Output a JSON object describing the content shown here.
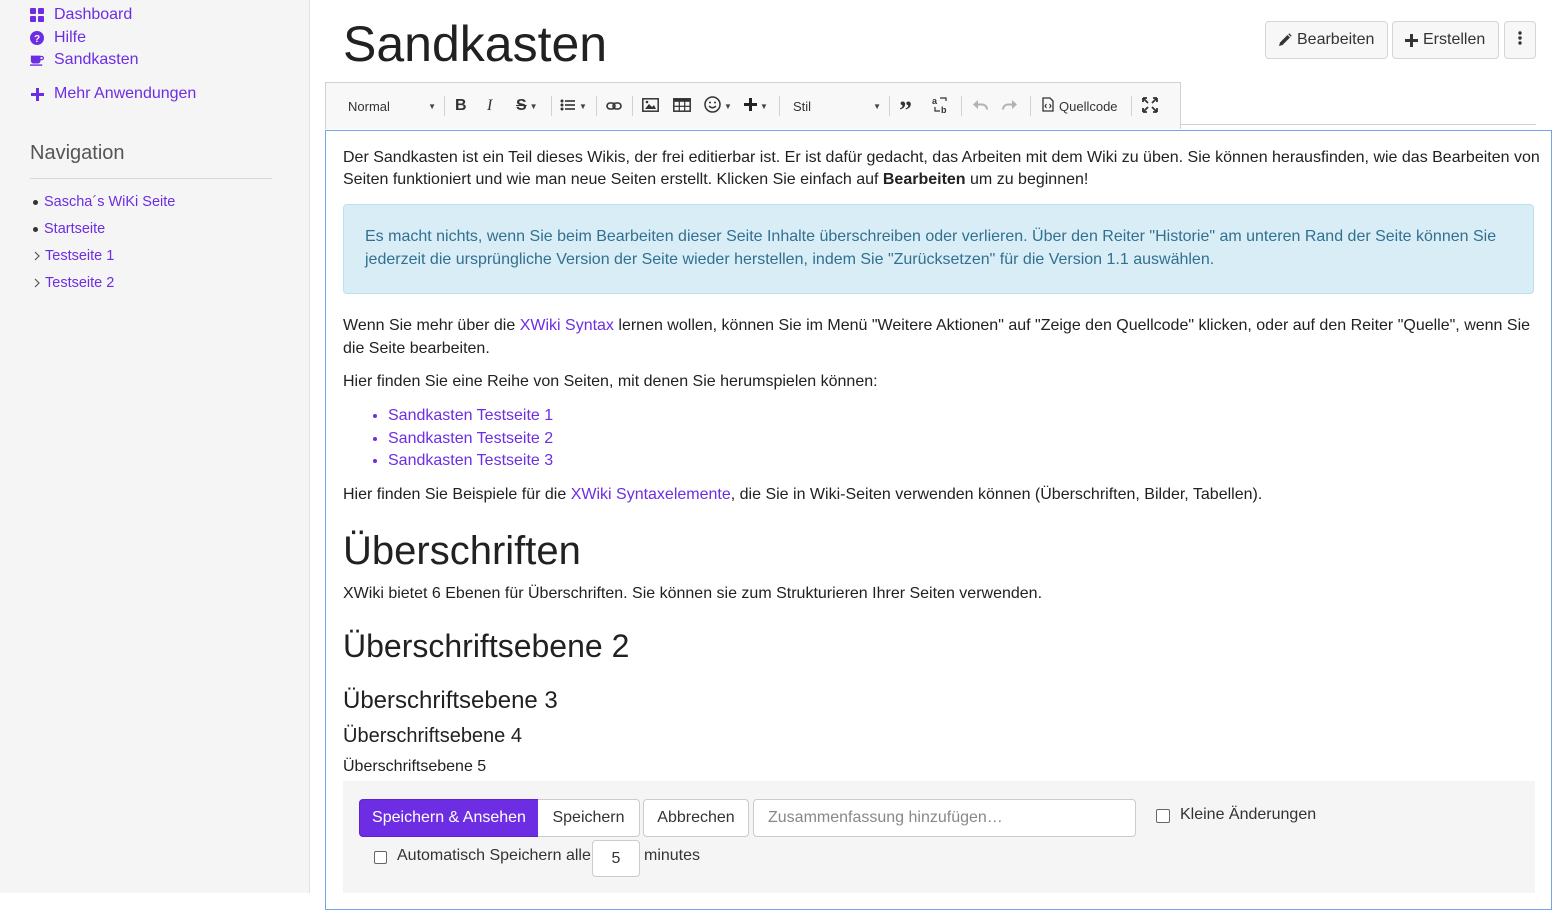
{
  "sidebar": {
    "apps": [
      {
        "label": "Dashboard",
        "icon": "dashboard-icon"
      },
      {
        "label": "Hilfe",
        "icon": "help-icon"
      },
      {
        "label": "Sandkasten",
        "icon": "coffee-icon"
      }
    ],
    "more_apps": "Mehr Anwendungen",
    "nav_title": "Navigation",
    "nav_items": [
      {
        "label": "Sascha´s WiKi Seite",
        "marker": "bullet"
      },
      {
        "label": "Startseite",
        "marker": "bullet"
      },
      {
        "label": "Testseite 1",
        "marker": "caret"
      },
      {
        "label": "Testseite 2",
        "marker": "caret"
      }
    ]
  },
  "header": {
    "title": "Sandkasten",
    "edit_label": "Bearbeiten",
    "create_label": "Erstellen"
  },
  "toolbar": {
    "format": "Normal",
    "style": "Stil",
    "source": "Quellcode"
  },
  "content": {
    "intro_1": "Der Sandkasten ist ein Teil dieses Wikis, der frei editierbar ist. Er ist dafür gedacht, das Arbeiten mit dem Wiki zu üben. Sie können herausfinden, wie das Bearbeiten von",
    "intro_2a": "Seiten funktioniert und wie man neue Seiten erstellt. Klicken Sie einfach auf ",
    "intro_2b": "Bearbeiten",
    "intro_2c": " um zu beginnen!",
    "info_1": "Es macht nichts, wenn Sie beim Bearbeiten dieser Seite Inhalte überschreiben oder verlieren. Über den Reiter \"Historie\" am unteren Rand der Seite können Sie",
    "info_2": "jederzeit die ursprüngliche Version der Seite wieder herstellen, indem Sie \"Zurücksetzen\" für die Version 1.1 auswählen.",
    "syntax_1a": "Wenn Sie mehr über die ",
    "syntax_1link": "XWiki Syntax",
    "syntax_1b": " lernen wollen, können Sie im Menü \"Weitere Aktionen\" auf \"Zeige den Quellcode\" klicken, oder auf den Reiter \"Quelle\", wenn Sie",
    "syntax_2": "die Seite bearbeiten.",
    "pages_intro": "Hier finden Sie eine Reihe von Seiten, mit denen Sie herumspielen können:",
    "pages": [
      "Sandkasten Testseite 1",
      "Sandkasten Testseite 2",
      "Sandkasten Testseite 3"
    ],
    "examples_a": "Hier finden Sie Beispiele für die ",
    "examples_link": "XWiki Syntaxelemente",
    "examples_b": ", die Sie in Wiki-Seiten verwenden können (Überschriften, Bilder, Tabellen).",
    "h1": "Überschriften",
    "h1_text": "XWiki bietet 6 Ebenen für Überschriften. Sie können sie zum Strukturieren Ihrer Seiten verwenden.",
    "h2": "Überschriftsebene 2",
    "h3": "Überschriftsebene 3",
    "h4": "Überschriftsebene 4",
    "h5": "Überschriftsebene 5"
  },
  "actions": {
    "save_view": "Speichern & Ansehen",
    "save": "Speichern",
    "cancel": "Abbrechen",
    "summary_placeholder": "Zusammenfassung hinzufügen…",
    "minor_changes": "Kleine Änderungen",
    "autosave_label": "Automatisch Speichern alle",
    "autosave_value": "5",
    "minutes": "minutes"
  },
  "colors": {
    "accent": "#6d2ee3",
    "info_bg": "#d9edf7",
    "info_text": "#31708f"
  }
}
